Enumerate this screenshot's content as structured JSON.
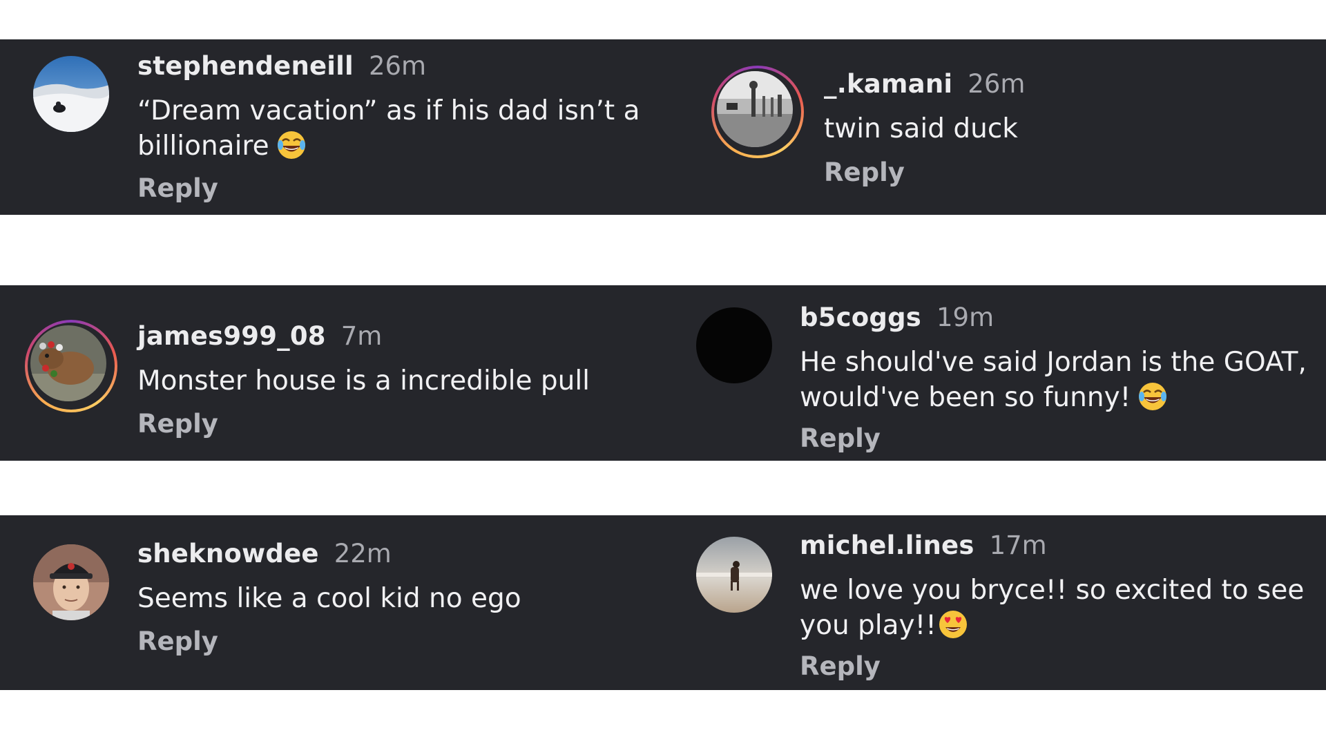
{
  "comments": [
    {
      "username": "stephendeneill",
      "time": "26m",
      "text": "“Dream vacation” as if his dad isn’t a billionaire",
      "emoji": "tears-of-joy-emoji",
      "reply": "Reply",
      "avatar": "snow-landscape-avatar"
    },
    {
      "username": "_.kamani",
      "time": "26m",
      "text": "twin said duck",
      "reply": "Reply",
      "avatar": "gym-photo-avatar",
      "story_ring": true
    },
    {
      "username": "james999_08",
      "time": "7m",
      "text": "Monster house is a incredible pull",
      "reply": "Reply",
      "avatar": "capybara-avatar",
      "story_ring": true
    },
    {
      "username": "b5coggs",
      "time": "19m",
      "text": "He should've said Jordan is the GOAT, would've been so funny!",
      "emoji": "tears-of-joy-emoji",
      "reply": "Reply",
      "avatar": "black-circle-avatar"
    },
    {
      "username": "sheknowdee",
      "time": "22m",
      "text": "Seems like a cool kid no ego",
      "reply": "Reply",
      "avatar": "man-in-cap-avatar"
    },
    {
      "username": "michel.lines",
      "time": "17m",
      "text": "we love you bryce!! so excited to see you play!!",
      "emoji": "heart-eyes-emoji",
      "reply": "Reply",
      "avatar": "horse-beach-avatar"
    }
  ],
  "colors": {
    "band_background": "#25262b",
    "page_background": "#ffffff",
    "username": "#ececee",
    "timestamp": "#a9aab0",
    "reply": "#b5b6bc",
    "story_ring_gradient": [
      "#8a3ab9",
      "#e95950",
      "#fccc63",
      "#fbad50",
      "#cd486b"
    ]
  }
}
